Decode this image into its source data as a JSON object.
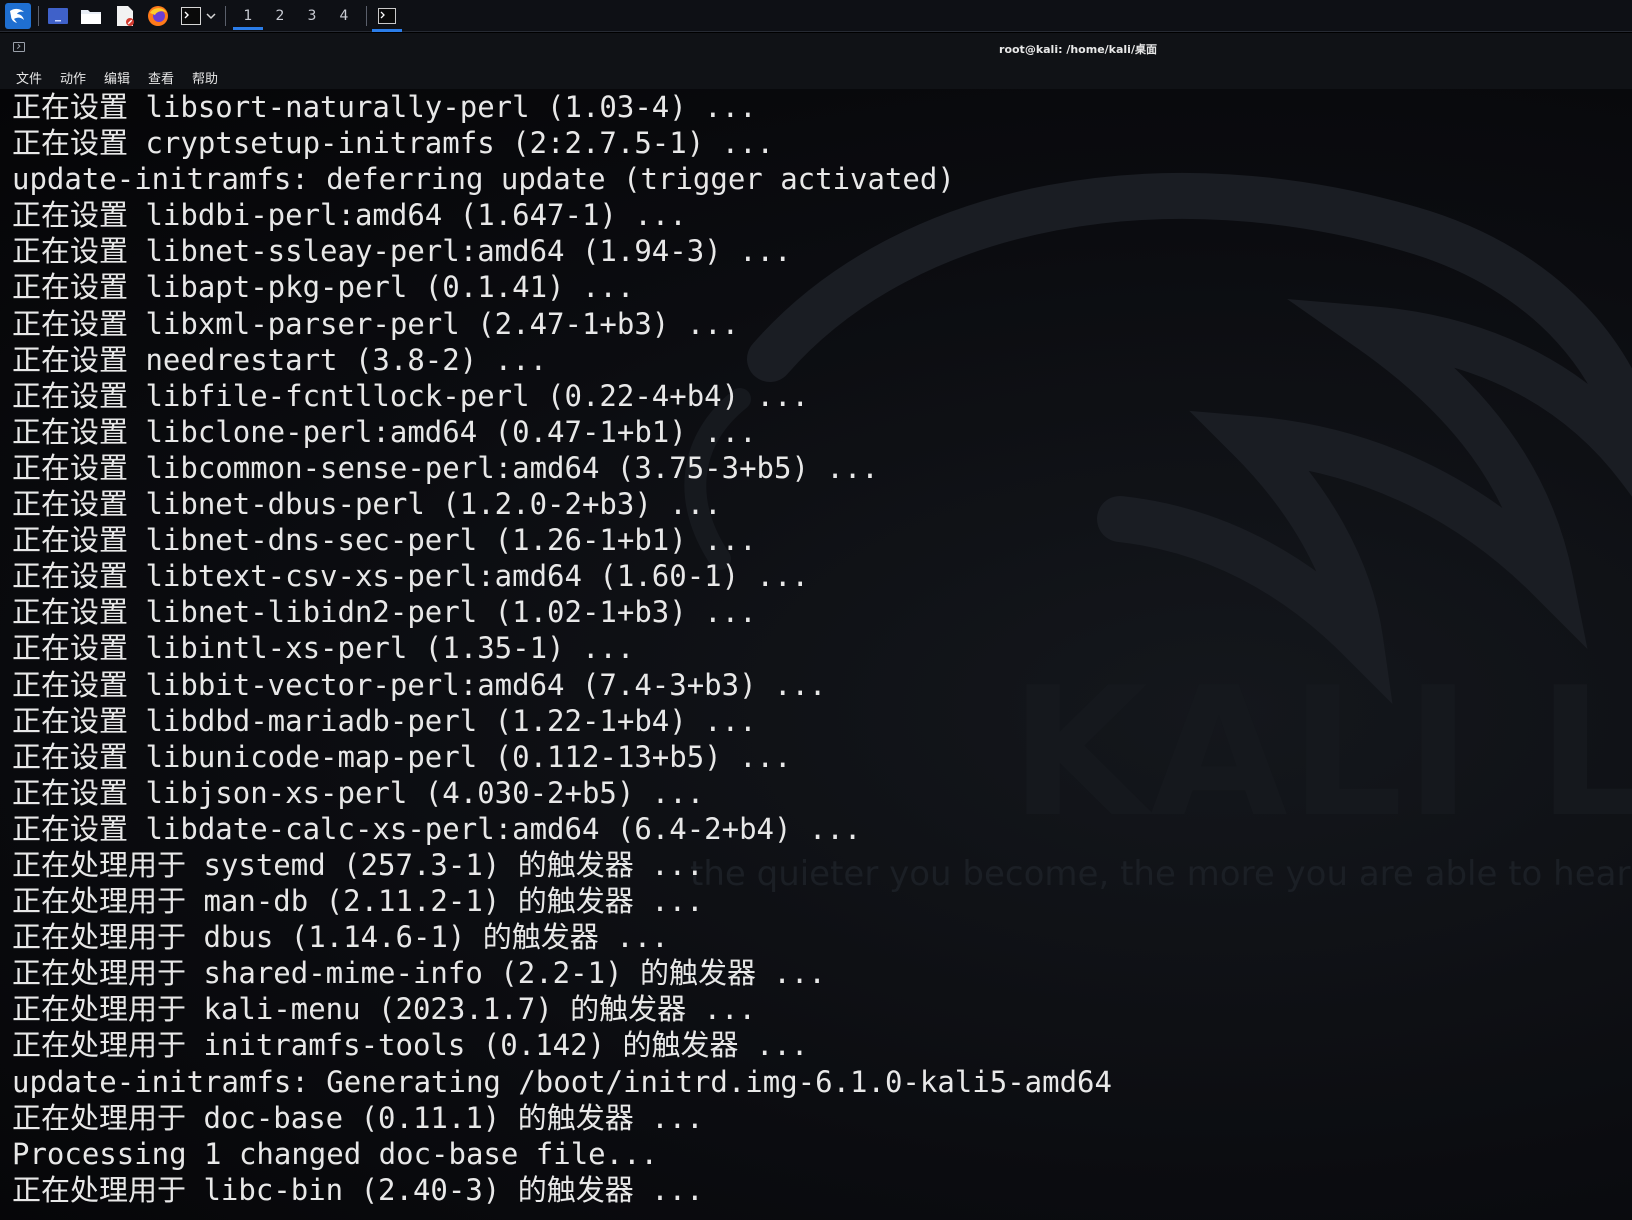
{
  "taskbar": {
    "apps": [
      {
        "name": "kali-menu-icon"
      },
      {
        "name": "desktop-icon"
      },
      {
        "name": "file-manager-icon"
      },
      {
        "name": "text-editor-icon"
      },
      {
        "name": "firefox-icon"
      },
      {
        "name": "terminal-icon"
      }
    ],
    "workspaces": [
      "1",
      "2",
      "3",
      "4"
    ],
    "active_workspace": "1",
    "accent": "#2b7de9"
  },
  "window": {
    "title": "root@kali: /home/kali/桌面"
  },
  "menu": {
    "items": [
      "文件",
      "动作",
      "编辑",
      "查看",
      "帮助"
    ]
  },
  "watermark": {
    "title": "KALI LINUX",
    "quote": "the quieter you become, the more you are able to hear"
  },
  "terminal": {
    "lines": [
      "正在设置 libsort-naturally-perl (1.03-4) ...",
      "正在设置 cryptsetup-initramfs (2:2.7.5-1) ...",
      "update-initramfs: deferring update (trigger activated)",
      "正在设置 libdbi-perl:amd64 (1.647-1) ...",
      "正在设置 libnet-ssleay-perl:amd64 (1.94-3) ...",
      "正在设置 libapt-pkg-perl (0.1.41) ...",
      "正在设置 libxml-parser-perl (2.47-1+b3) ...",
      "正在设置 needrestart (3.8-2) ...",
      "正在设置 libfile-fcntllock-perl (0.22-4+b4) ...",
      "正在设置 libclone-perl:amd64 (0.47-1+b1) ...",
      "正在设置 libcommon-sense-perl:amd64 (3.75-3+b5) ...",
      "正在设置 libnet-dbus-perl (1.2.0-2+b3) ...",
      "正在设置 libnet-dns-sec-perl (1.26-1+b1) ...",
      "正在设置 libtext-csv-xs-perl:amd64 (1.60-1) ...",
      "正在设置 libnet-libidn2-perl (1.02-1+b3) ...",
      "正在设置 libintl-xs-perl (1.35-1) ...",
      "正在设置 libbit-vector-perl:amd64 (7.4-3+b3) ...",
      "正在设置 libdbd-mariadb-perl (1.22-1+b4) ...",
      "正在设置 libunicode-map-perl (0.112-13+b5) ...",
      "正在设置 libjson-xs-perl (4.030-2+b5) ...",
      "正在设置 libdate-calc-xs-perl:amd64 (6.4-2+b4) ...",
      "正在处理用于 systemd (257.3-1) 的触发器 ...",
      "正在处理用于 man-db (2.11.2-1) 的触发器 ...",
      "正在处理用于 dbus (1.14.6-1) 的触发器 ...",
      "正在处理用于 shared-mime-info (2.2-1) 的触发器 ...",
      "正在处理用于 kali-menu (2023.1.7) 的触发器 ...",
      "正在处理用于 initramfs-tools (0.142) 的触发器 ...",
      "update-initramfs: Generating /boot/initrd.img-6.1.0-kali5-amd64",
      "正在处理用于 doc-base (0.11.1) 的触发器 ...",
      "Processing 1 changed doc-base file...",
      "正在处理用于 libc-bin (2.40-3) 的触发器 ..."
    ],
    "text_color": "#e8e8e8",
    "background": "#0b0c10"
  }
}
